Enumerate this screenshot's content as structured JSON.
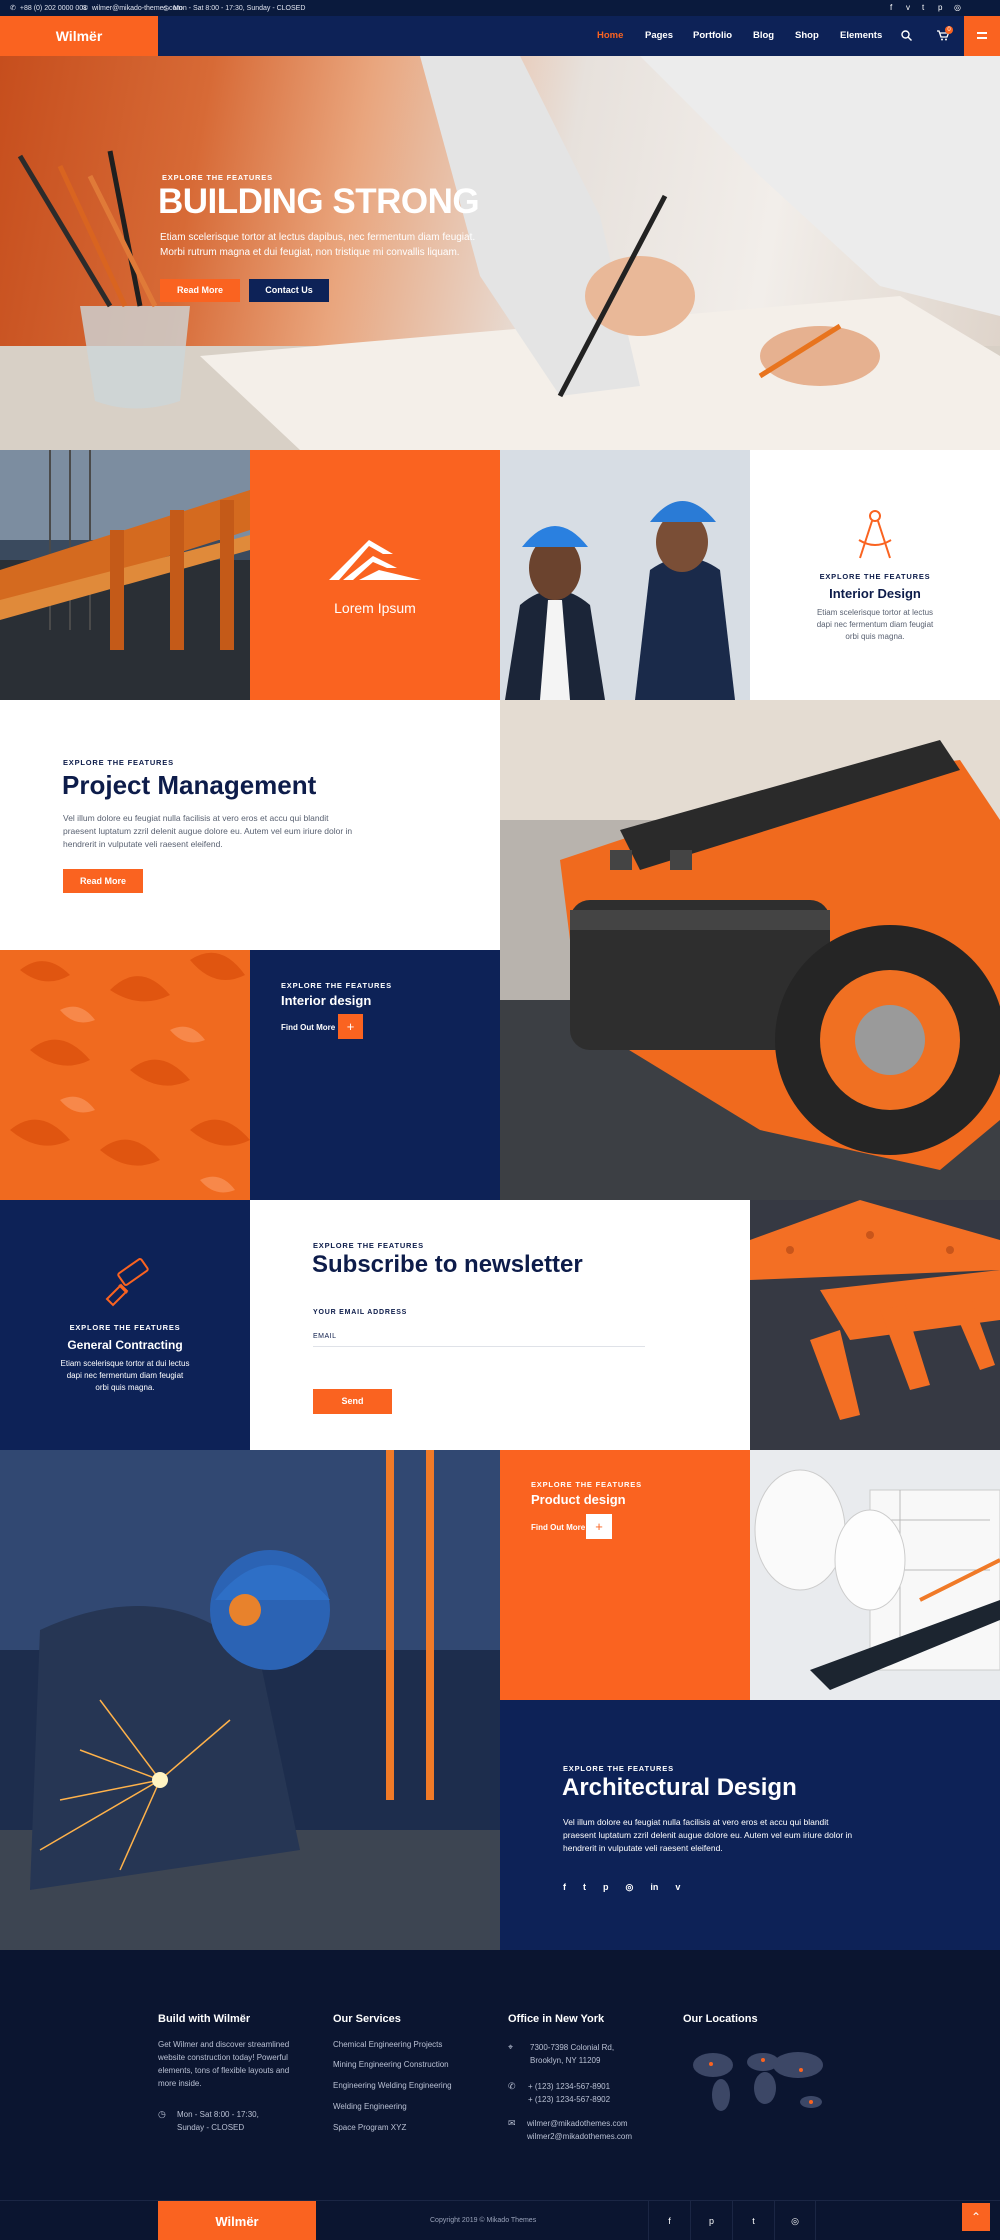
{
  "topbar": {
    "phone": "+88 (0) 202 0000 001",
    "email": "wilmer@mikado-themes.com",
    "hours": "Mon - Sat 8:00 - 17:30, Sunday - CLOSED"
  },
  "brand": {
    "logo": "Wilmër"
  },
  "nav": {
    "items": [
      "Home",
      "Pages",
      "Portfolio",
      "Blog",
      "Shop",
      "Elements"
    ],
    "active": "Home",
    "cart_count": "0"
  },
  "hero": {
    "kicker": "EXPLORE THE FEATURES",
    "title": "BUILDING STRONG",
    "text": "Etiam scelerisque tortor at lectus dapibus, nec fermentum diam feugiat. Morbi rutrum magna et dui feugiat, non tristique mi convallis liquam.",
    "btn_primary": "Read More",
    "btn_secondary": "Contact Us"
  },
  "tiles": {
    "lorem": "Lorem Ipsum",
    "interior1": {
      "kicker": "EXPLORE THE FEATURES",
      "title": "Interior Design",
      "text": "Etiam scelerisque tortor at lectus dapi nec fermentum diam feugiat orbi quis magna."
    },
    "pm": {
      "kicker": "EXPLORE THE FEATURES",
      "title": "Project Management",
      "text": "Vel illum dolore eu feugiat nulla facilisis at vero eros et accu qui blandit praesent luptatum zzril delenit augue dolore eu. Autem vel eum iriure dolor in hendrerit in vulputate veli raesent eleifend.",
      "btn": "Read More"
    },
    "interior2": {
      "kicker": "EXPLORE THE FEATURES",
      "title": "Interior design",
      "link": "Find Out More"
    },
    "gc": {
      "kicker": "EXPLORE THE FEATURES",
      "title": "General Contracting",
      "text": "Etiam scelerisque tortor at dui lectus dapi nec fermentum diam feugiat orbi quis magna."
    },
    "newsletter": {
      "kicker": "EXPLORE THE FEATURES",
      "title": "Subscribe to newsletter",
      "label": "YOUR EMAIL ADDRESS",
      "placeholder": "EMAIL",
      "btn": "Send"
    },
    "pd": {
      "kicker": "EXPLORE THE FEATURES",
      "title": "Product design",
      "link": "Find Out More"
    },
    "arch": {
      "kicker": "EXPLORE THE FEATURES",
      "title": "Architectural Design",
      "text": "Vel illum dolore eu feugiat nulla facilisis at vero eros et accu qui blandit praesent luptatum zzril delenit augue dolore eu. Autem vel eum iriure dolor in hendrerit in vulputate veli raesent eleifend."
    }
  },
  "social": {
    "icons": [
      "f",
      "t",
      "p",
      "in"
    ]
  },
  "footer": {
    "col1": {
      "title": "Build with Wilmër",
      "text": "Get Wilmer and discover streamlined website construction today! Powerful elements, tons of flexible layouts and more inside.",
      "hours1": "Mon - Sat 8:00 - 17:30,",
      "hours2": "Sunday - CLOSED"
    },
    "col2": {
      "title": "Our Services",
      "items": [
        "Chemical Engineering Projects",
        "Mining Engineering Construction",
        "Engineering Welding Engineering",
        "Welding Engineering",
        "Space Program XYZ"
      ]
    },
    "col3": {
      "title": "Office in New York",
      "addr1": "7300-7398 Colonial Rd,",
      "addr2": "Brooklyn, NY 11209",
      "phone1": "+ (123) 1234-567-8901",
      "phone2": "+ (123) 1234-567-8902",
      "mail1": "wilmer@mikadothemes.com",
      "mail2": "wilmer2@mikadothemes.com"
    },
    "col4": {
      "title": "Our Locations"
    },
    "copyright": "Copyright 2019 © Mikado Themes",
    "logo": "Wilmër"
  },
  "colors": {
    "orange": "#fa6320",
    "navy": "#0d2257",
    "dark": "#0b1530"
  }
}
